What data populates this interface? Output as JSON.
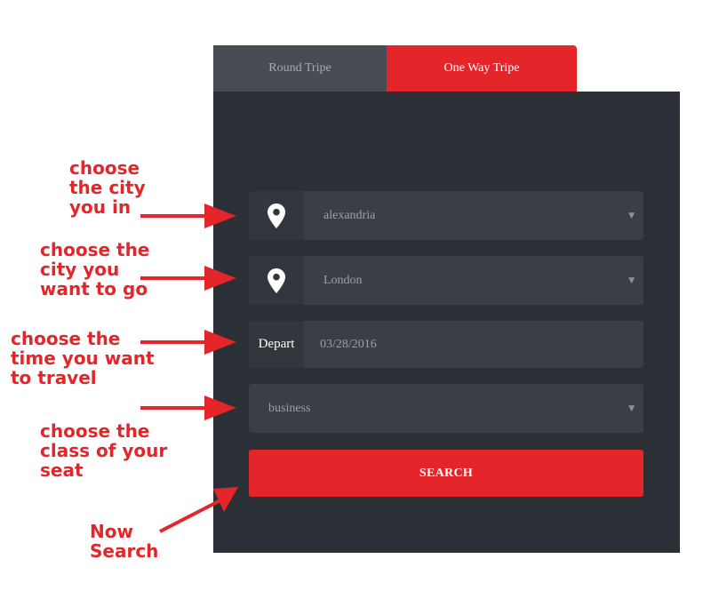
{
  "tabs": {
    "round_trip": "Round Tripe",
    "one_way": "One Way Tripe",
    "active": "one_way"
  },
  "form": {
    "from_city": "alexandria",
    "to_city": "London",
    "depart_label": "Depart",
    "depart_date": "03/28/2016",
    "seat_class": "business",
    "search_label": "SEARCH",
    "caret": "▼"
  },
  "annotations": {
    "from": [
      "choose",
      "the city",
      "you in"
    ],
    "to": [
      "choose the",
      "city you",
      "want to go"
    ],
    "time": [
      "choose the",
      "time you want",
      "to travel"
    ],
    "class": [
      "choose the",
      "class of your",
      "seat"
    ],
    "search": [
      "Now",
      "Search"
    ]
  },
  "colors": {
    "accent_red": "#e4262b",
    "panel_bg": "#2b3036",
    "field_bg": "#3a3f46",
    "inactive_tab": "#474c52"
  },
  "icons": {
    "from_city": "map-pin-icon",
    "to_city": "map-pin-icon",
    "select": "caret-down-icon"
  }
}
